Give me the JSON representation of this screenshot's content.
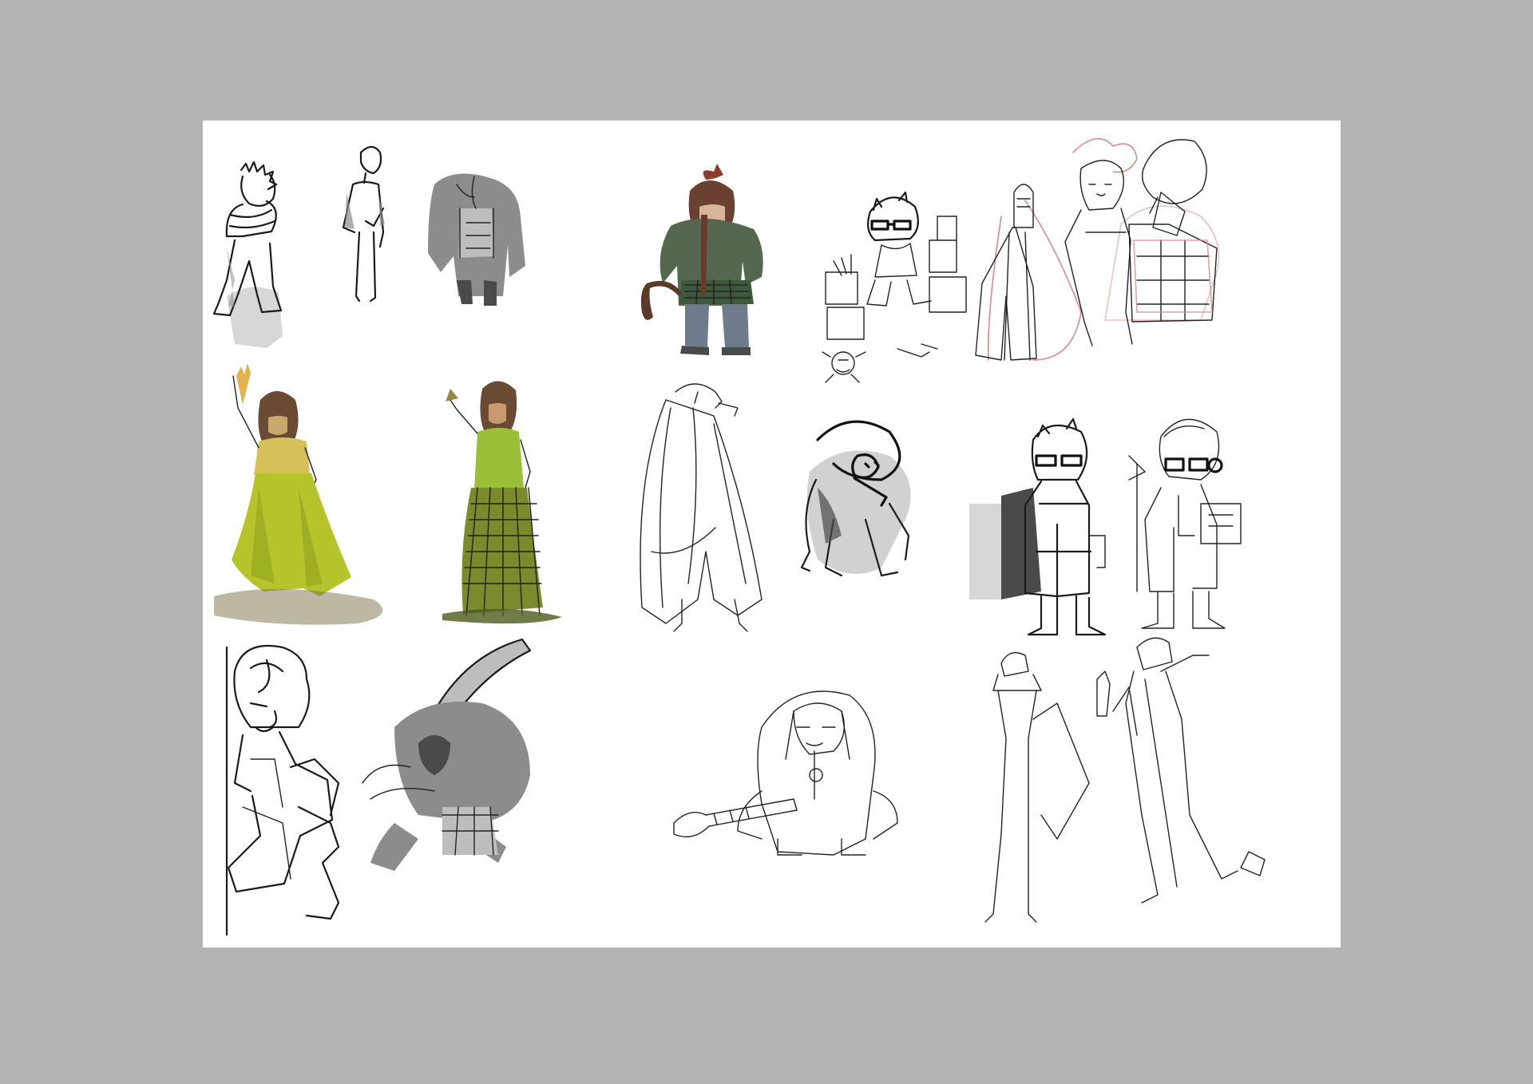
{
  "colors": {
    "background": "#b3b3b3",
    "sheet": "#ffffff",
    "ink": "#1a1a1a",
    "skirt_green": "#b5c42a",
    "jacket_green": "#5d6e56",
    "plaid_green": "#7c8a2e",
    "sketch_red": "#d98a8a"
  },
  "sheet": {
    "rows": [
      {
        "figures": [
          "boy-with-crossed-arms",
          "tall-thin-man",
          "hooded-large-figure",
          "girl-with-hockey-stick",
          "kid-with-glasses-and-boxes",
          "red-pencil-trio"
        ]
      },
      {
        "figures": [
          "woman-in-green-skirt",
          "woman-in-plaid-skirt",
          "tall-cloaked-figure",
          "hunched-creature",
          "man-with-glasses-and-coat",
          "kid-with-headphones"
        ]
      },
      {
        "figures": [
          "curly-haired-woman-crouching",
          "figure-swinging-hockey-stick",
          "large-figure-with-hockey-stick",
          "two-tall-thin-figures"
        ]
      }
    ]
  }
}
